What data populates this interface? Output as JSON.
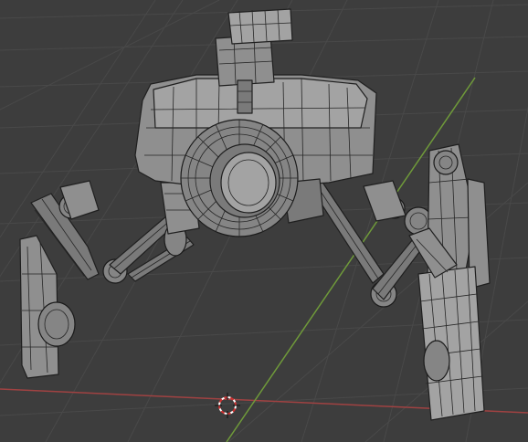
{
  "viewport": {
    "background": "#3d3d3d",
    "grid_color": "#494949",
    "x_axis_color": "#a04242",
    "y_axis_color": "#6f9a3a",
    "mesh_color": "#8f8f8f",
    "wire_color": "#1f1f1f"
  },
  "scene": {
    "object": "walker-robot-mesh",
    "shading": "solid-wireframe-overlay",
    "cursor": "3d-cursor-icon"
  }
}
